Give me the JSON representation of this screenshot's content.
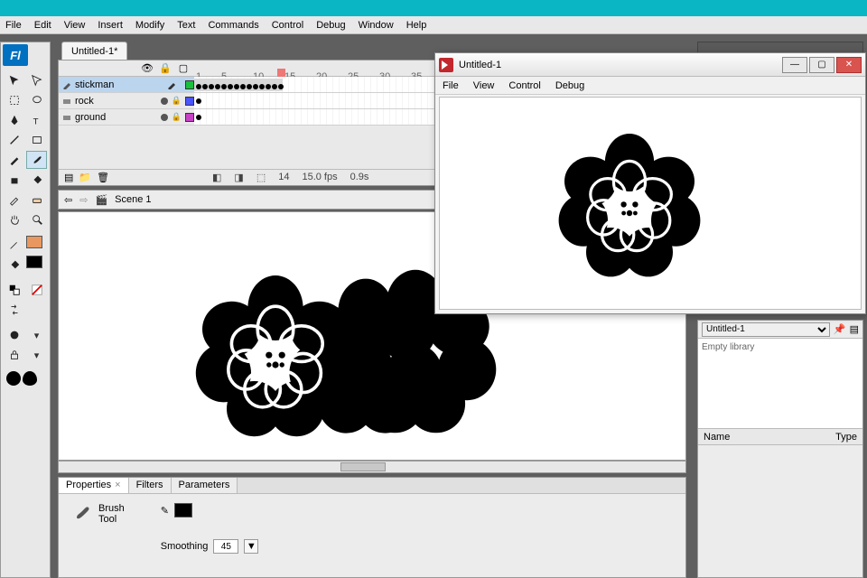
{
  "menu": {
    "file": "File",
    "edit": "Edit",
    "view": "View",
    "insert": "Insert",
    "modify": "Modify",
    "text": "Text",
    "commands": "Commands",
    "control": "Control",
    "debug": "Debug",
    "window": "Window",
    "help": "Help"
  },
  "app_icon_label": "Fl",
  "document": {
    "tab_title": "Untitled-1*"
  },
  "timeline": {
    "ruler": [
      "1",
      "5",
      "10",
      "15",
      "20",
      "25",
      "30",
      "35"
    ],
    "layers": [
      {
        "name": "stickman",
        "selected": true,
        "color": "#1abf3c"
      },
      {
        "name": "rock",
        "selected": false,
        "color": "#4a54ff"
      },
      {
        "name": "ground",
        "selected": false,
        "color": "#c542c5"
      }
    ],
    "current_frame": "14",
    "fps": "15.0 fps",
    "elapsed": "0.9s"
  },
  "scene": {
    "label": "Scene 1"
  },
  "properties": {
    "tabs": {
      "properties": "Properties",
      "filters": "Filters",
      "parameters": "Parameters"
    },
    "tool_name_1": "Brush",
    "tool_name_2": "Tool",
    "smoothing_label": "Smoothing",
    "smoothing_value": "45"
  },
  "library": {
    "doc_name": "Untitled-1",
    "empty_text": "Empty library",
    "col_name": "Name",
    "col_type": "Type"
  },
  "player": {
    "title": "Untitled-1",
    "menu": {
      "file": "File",
      "view": "View",
      "control": "Control",
      "debug": "Debug"
    }
  }
}
